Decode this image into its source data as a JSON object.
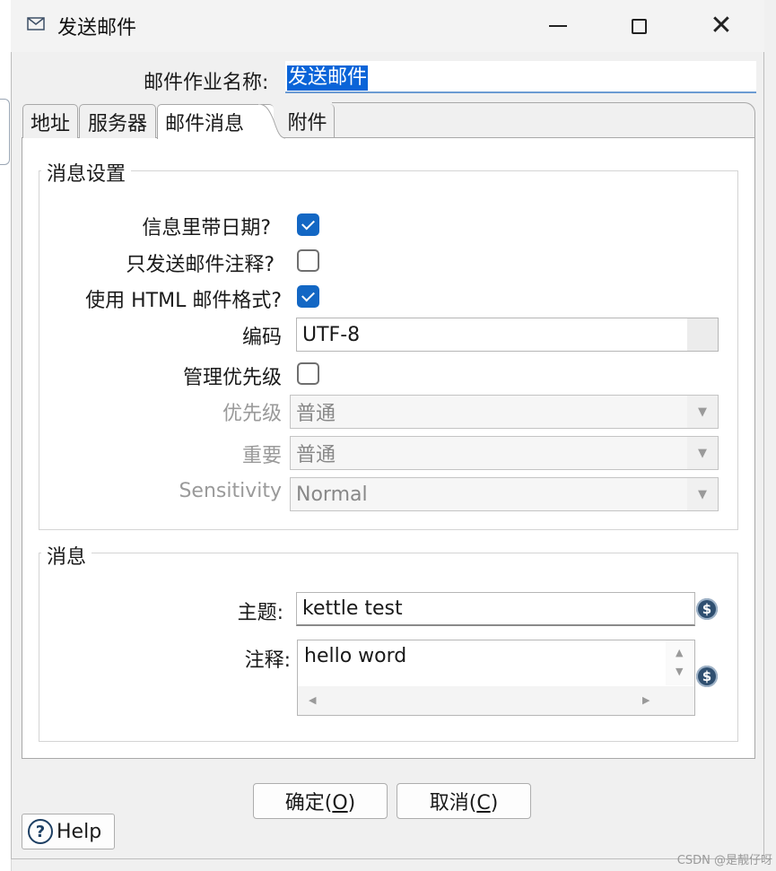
{
  "window": {
    "title": "发送邮件",
    "icon": "mail-icon"
  },
  "job_name": {
    "label": "邮件作业名称:",
    "value": "发送邮件"
  },
  "tabs": [
    {
      "label": "地址"
    },
    {
      "label": "服务器"
    },
    {
      "label": "邮件消息",
      "active": true
    },
    {
      "label": "附件"
    }
  ],
  "message_settings": {
    "title": "消息设置",
    "include_date": {
      "label": "信息里带日期?",
      "checked": true
    },
    "only_comment": {
      "label": "只发送邮件注释?",
      "checked": false
    },
    "use_html": {
      "label": "使用 HTML 邮件格式?",
      "checked": true
    },
    "encoding": {
      "label": "编码",
      "value": "UTF-8"
    },
    "manage_priority": {
      "label": "管理优先级",
      "checked": false
    },
    "priority": {
      "label": "优先级",
      "value": "普通"
    },
    "importance": {
      "label": "重要",
      "value": "普通"
    },
    "sensitivity": {
      "label": "Sensitivity",
      "value": "Normal"
    }
  },
  "message": {
    "title": "消息",
    "subject": {
      "label": "主题:",
      "value": "kettle test"
    },
    "comment": {
      "label": "注释:",
      "value": "hello word"
    }
  },
  "buttons": {
    "ok": "确定(O)",
    "ok_prefix": "确定(",
    "ok_key": "O",
    "cancel": "取消(C)",
    "cancel_prefix": "取消(",
    "cancel_key": "C",
    "close_paren": ")",
    "help": "Help"
  },
  "watermark": "CSDN @是靓仔呀",
  "colors": {
    "accent": "#1367c4",
    "selection": "#0a64d8",
    "variable_icon": "#2f4f70"
  }
}
